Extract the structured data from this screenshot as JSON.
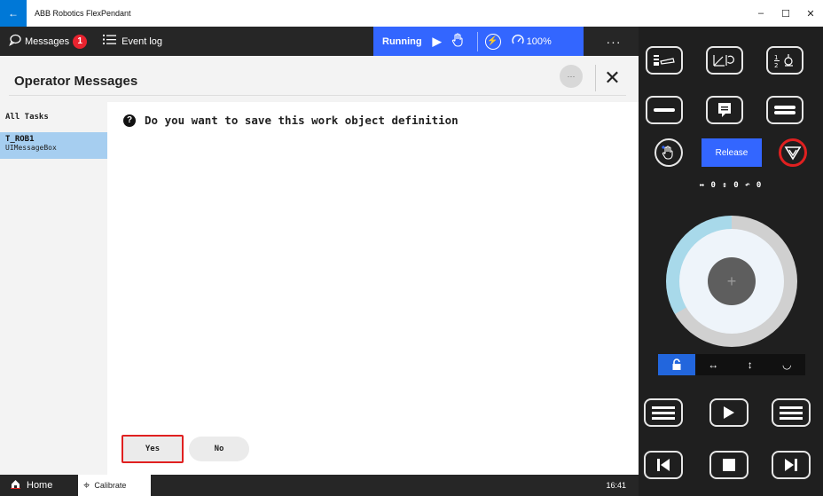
{
  "window": {
    "title": "ABB Robotics FlexPendant",
    "back_glyph": "←",
    "min_glyph": "–",
    "max_glyph": "☐",
    "close_glyph": "✕"
  },
  "appbar": {
    "messages_label": "Messages",
    "messages_badge": "1",
    "event_log_label": "Event log",
    "status_label": "Running",
    "speed_label": "100%",
    "more_glyph": "···"
  },
  "panel": {
    "title": "Operator Messages",
    "more_glyph": "···",
    "close_glyph": "✕"
  },
  "sidebar": {
    "all_tasks_label": "All Tasks",
    "tasks": [
      {
        "name": "T_ROB1",
        "source": "UIMessageBox"
      }
    ]
  },
  "message": {
    "text": "Do you want to save this work object definition",
    "icon": "question-icon"
  },
  "buttons": {
    "yes_label": "Yes",
    "no_label": "No"
  },
  "bottombar": {
    "home_label": "Home",
    "calibrate_label": "Calibrate",
    "time": "16:41"
  },
  "jog": {
    "release_label": "Release",
    "axis_readout": "↔ 0  ↕ 0  ↶ 0",
    "joystick_plus": "+",
    "colors": {
      "accent": "#3366ff",
      "stop": "#e02020",
      "dial_active": "#a8d9ea"
    }
  }
}
